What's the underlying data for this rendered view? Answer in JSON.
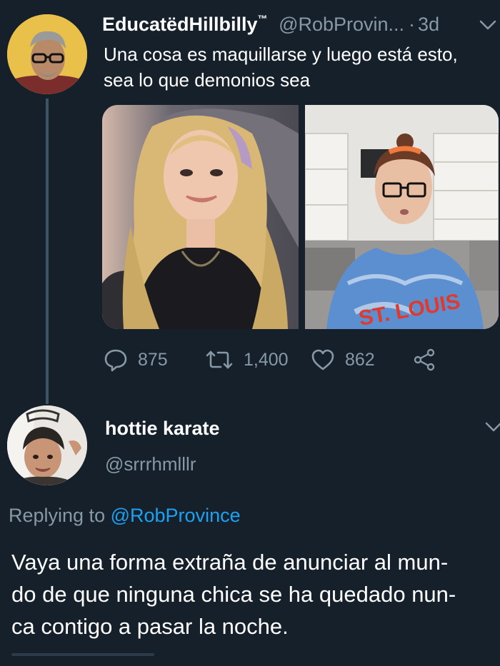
{
  "tweet": {
    "author_name": "EducatëdHillbilly",
    "author_tm": "™",
    "author_handle": "@RobProvin...",
    "dot": "·",
    "time": "3d",
    "text": "Una cosa es maquillarse y luego está esto, sea lo que demonios sea",
    "avatar_icon": "profile-avatar",
    "media_icons": [
      "photo-woman-long-blonde-hair",
      "photo-woman-glasses-st-louis-hoodie"
    ],
    "media_lettering": "ST. LOUIS",
    "stats": {
      "replies": "875",
      "retweets": "1,400",
      "likes": "862"
    },
    "action_icons": [
      "comment-icon",
      "retweet-icon",
      "heart-icon",
      "share-icon"
    ]
  },
  "reply": {
    "author_name": "hottie karate",
    "author_handle": "@srrrhmlllr",
    "replying_prefix": "Replying to",
    "replying_to": "@RobProvince",
    "text_line1": "Vaya una forma extraña de anunciar al mun-",
    "text_line2": "do de que ninguna chica se ha quedado nun-",
    "text_line3": "ca contigo a pasar la noche.",
    "avatar_icon": "profile-avatar"
  },
  "colors": {
    "background": "#15202b",
    "primary_text": "#ffffff",
    "secondary_text": "#8899a6",
    "accent": "#1da1f2",
    "thread_line": "#3d5466"
  }
}
